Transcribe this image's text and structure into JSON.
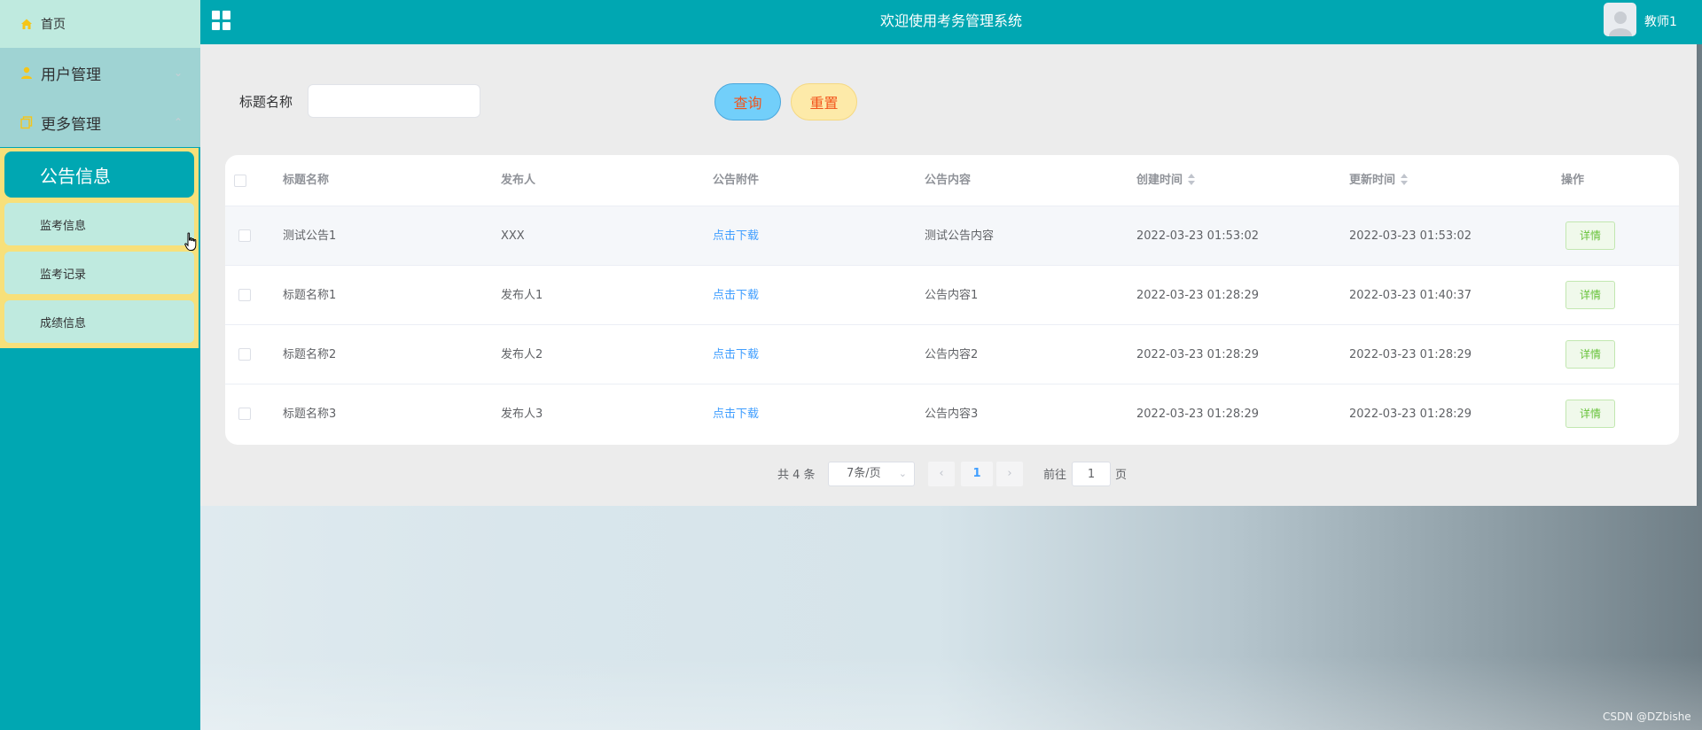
{
  "header": {
    "title": "欢迎使用考务管理系统",
    "user_name": "教师1",
    "grid_icon": "grid-icon",
    "avatar_icon": "user-avatar-icon",
    "background_color": "#00a7b2"
  },
  "sidebar": {
    "home": {
      "label": "首页",
      "icon": "home-icon"
    },
    "groups": [
      {
        "label": "用户管理",
        "icon": "user-icon",
        "chevron": "chevron-down-icon"
      },
      {
        "label": "更多管理",
        "icon": "copy-icon",
        "chevron": "chevron-up-icon"
      }
    ],
    "sub_items": [
      {
        "label": "公告信息",
        "active": true
      },
      {
        "label": "监考信息",
        "active": false
      },
      {
        "label": "监考记录",
        "active": false
      },
      {
        "label": "成绩信息",
        "active": false
      }
    ],
    "accent_color": "#00a7b2",
    "submenu_panel_color": "#f7e07a"
  },
  "search": {
    "label": "标题名称",
    "value": "",
    "placeholder": "",
    "query_label": "查询",
    "reset_label": "重置"
  },
  "table": {
    "columns": [
      "标题名称",
      "发布人",
      "公告附件",
      "公告内容",
      "创建时间",
      "更新时间",
      "操作"
    ],
    "sortable_columns": [
      "创建时间",
      "更新时间"
    ],
    "rows": [
      {
        "title": "测试公告1",
        "publisher": "XXX",
        "attachment": "点击下载",
        "content": "测试公告内容",
        "created": "2022-03-23 01:53:02",
        "updated": "2022-03-23 01:53:02",
        "action": "详情"
      },
      {
        "title": "标题名称1",
        "publisher": "发布人1",
        "attachment": "点击下载",
        "content": "公告内容1",
        "created": "2022-03-23 01:28:29",
        "updated": "2022-03-23 01:40:37",
        "action": "详情"
      },
      {
        "title": "标题名称2",
        "publisher": "发布人2",
        "attachment": "点击下载",
        "content": "公告内容2",
        "created": "2022-03-23 01:28:29",
        "updated": "2022-03-23 01:28:29",
        "action": "详情"
      },
      {
        "title": "标题名称3",
        "publisher": "发布人3",
        "attachment": "点击下载",
        "content": "公告内容3",
        "created": "2022-03-23 01:28:29",
        "updated": "2022-03-23 01:28:29",
        "action": "详情"
      }
    ]
  },
  "pagination": {
    "total_text": "共 4 条",
    "page_size": "7条/页",
    "current_page": "1",
    "goto_label": "前往",
    "goto_value": "1",
    "page_suffix": "页"
  },
  "watermark": "CSDN @DZbishe"
}
